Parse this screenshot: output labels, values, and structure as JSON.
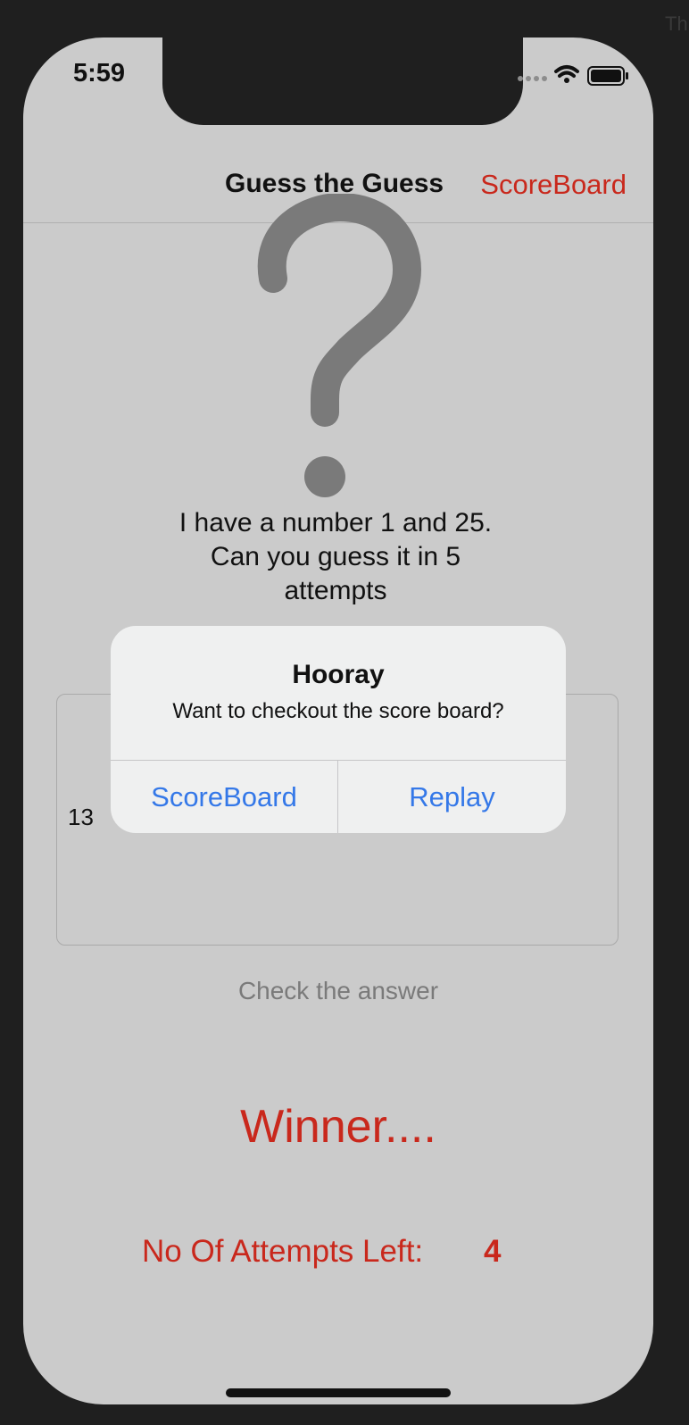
{
  "background_corner_text": "Th",
  "status_bar": {
    "time": "5:59",
    "icons": [
      "signal-dots-icon",
      "wifi-icon",
      "battery-icon"
    ]
  },
  "nav": {
    "title": "Guess the Guess",
    "right_button": "ScoreBoard"
  },
  "main": {
    "hero_icon": "question-mark-icon",
    "prompt_line1": "I have a number 1 and 25.",
    "prompt_line2": "Can you guess it in 5",
    "prompt_line3": "attempts",
    "input_value": "13",
    "check_button": "Check the answer",
    "result_text": "Winner....",
    "attempts_label": "No Of Attempts Left:",
    "attempts_value": "4"
  },
  "alert": {
    "title": "Hooray",
    "message": "Want to checkout the score board?",
    "buttons": [
      "ScoreBoard",
      "Replay"
    ]
  },
  "colors": {
    "accent_red": "#c9281c",
    "alert_blue": "#3478e8",
    "screen_bg": "#cbcbcb",
    "frame": "#1f1f1f"
  }
}
